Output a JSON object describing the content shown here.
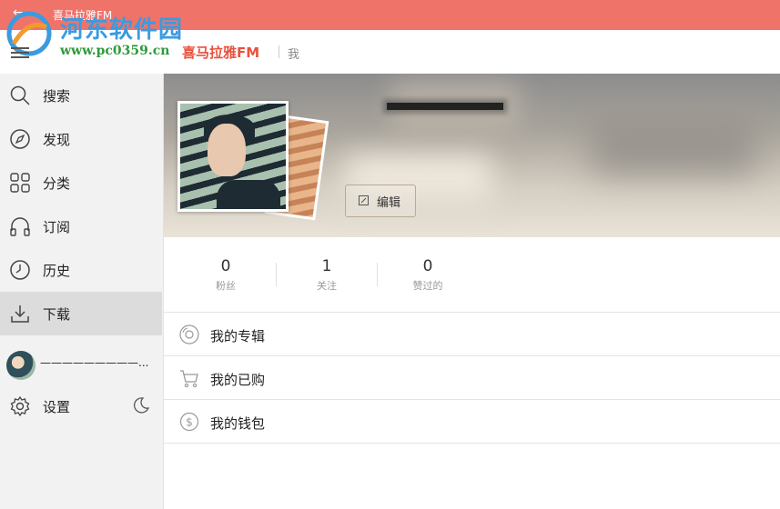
{
  "window": {
    "title": "喜马拉雅FM",
    "back_icon": "arrow-left-icon"
  },
  "watermark": {
    "title": "河东软件园",
    "url": "www.pc0359.cn"
  },
  "header": {
    "brand": "喜马拉雅FM",
    "breadcrumb": "我"
  },
  "sidebar": {
    "items": [
      {
        "label": "搜索",
        "icon": "search-icon"
      },
      {
        "label": "发现",
        "icon": "compass-icon"
      },
      {
        "label": "分类",
        "icon": "grid-icon"
      },
      {
        "label": "订阅",
        "icon": "headphones-icon"
      },
      {
        "label": "历史",
        "icon": "clock-icon"
      },
      {
        "label": "下载",
        "icon": "download-icon",
        "active": true
      }
    ],
    "user": {
      "name": "—————————..."
    },
    "settings": {
      "label": "设置",
      "icon": "gear-icon"
    },
    "night_mode_icon": "moon-icon"
  },
  "profile": {
    "edit_label": "编辑",
    "stats": [
      {
        "value": "0",
        "label": "粉丝"
      },
      {
        "value": "1",
        "label": "关注"
      },
      {
        "value": "0",
        "label": "赞过的"
      }
    ]
  },
  "menu": [
    {
      "label": "我的专辑",
      "icon": "album-icon"
    },
    {
      "label": "我的已购",
      "icon": "cart-icon"
    },
    {
      "label": "我的钱包",
      "icon": "wallet-icon"
    }
  ],
  "colors": {
    "accent": "#f0736a",
    "brand": "#e8523e",
    "active_bg": "#dcdcdc"
  }
}
